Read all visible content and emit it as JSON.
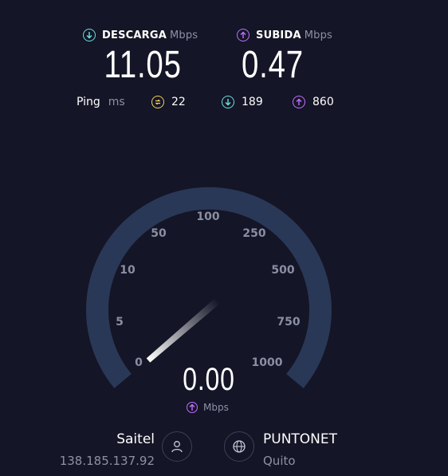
{
  "download": {
    "label": "DESCARGA",
    "unit": "Mbps",
    "value": "11.05",
    "icon": "download-arrow-icon",
    "color": "#6be0e0"
  },
  "upload": {
    "label": "SUBIDA",
    "unit": "Mbps",
    "value": "0.47",
    "icon": "upload-arrow-icon",
    "color": "#bf71ff"
  },
  "ping": {
    "label": "Ping",
    "unit": "ms",
    "idle": "22",
    "download": "189",
    "upload": "860",
    "idle_color": "#f2d15a"
  },
  "gauge": {
    "ticks": [
      "0",
      "5",
      "10",
      "50",
      "100",
      "250",
      "500",
      "750",
      "1000"
    ],
    "value": "0.00",
    "unit": "Mbps",
    "needle_value": 0,
    "track_color": "#2a3857"
  },
  "client": {
    "isp": "Saitel",
    "ip": "138.185.137.92"
  },
  "server": {
    "name": "PUNTONET",
    "location": "Quito"
  }
}
